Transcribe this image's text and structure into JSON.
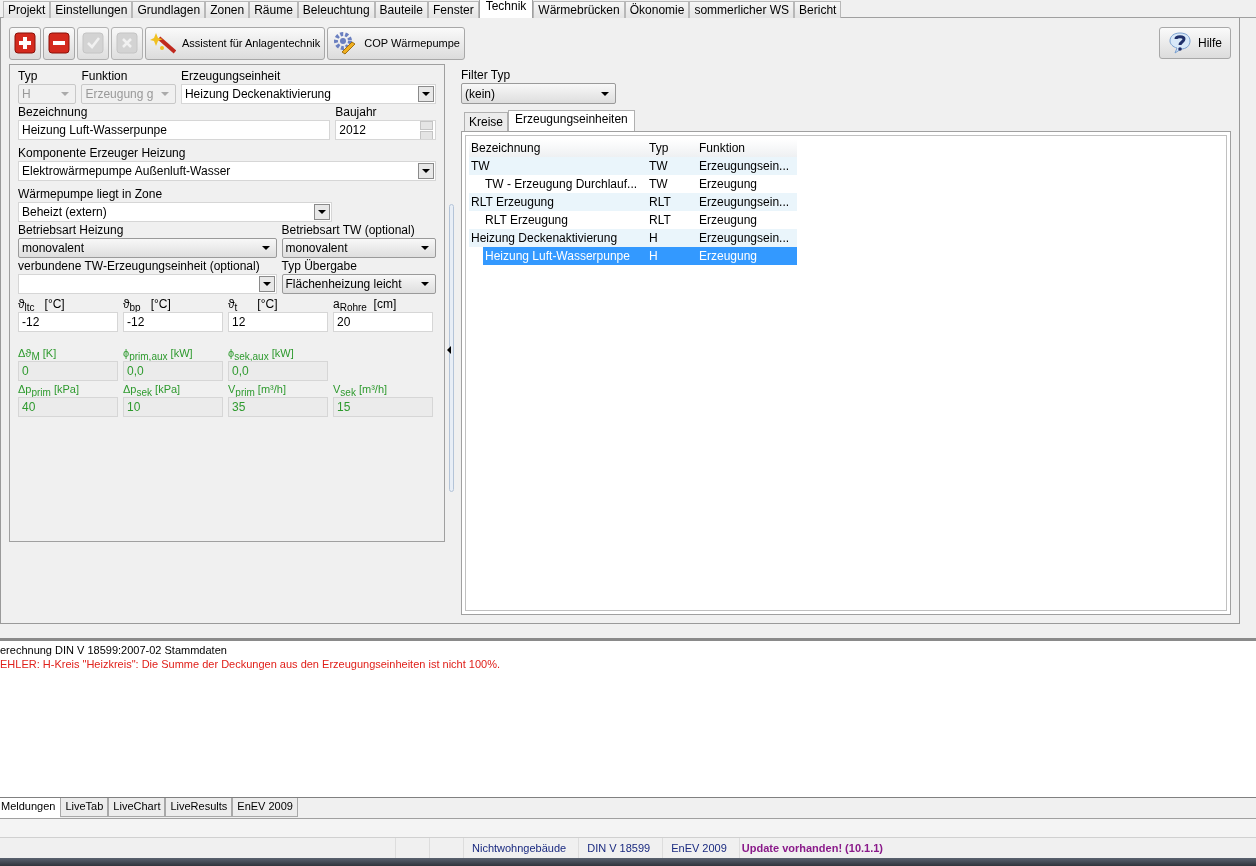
{
  "main_tabs": [
    {
      "label": "Projekt",
      "selected": false
    },
    {
      "label": "Einstellungen",
      "selected": false
    },
    {
      "label": "Grundlagen",
      "selected": false
    },
    {
      "label": "Zonen",
      "selected": false
    },
    {
      "label": "Räume",
      "selected": false
    },
    {
      "label": "Beleuchtung",
      "selected": false
    },
    {
      "label": "Bauteile",
      "selected": false
    },
    {
      "label": "Fenster",
      "selected": false
    },
    {
      "label": "Technik",
      "selected": true
    },
    {
      "label": "Wärmebrücken",
      "selected": false
    },
    {
      "label": "Ökonomie",
      "selected": false
    },
    {
      "label": "sommerlicher WS",
      "selected": false
    },
    {
      "label": "Bericht",
      "selected": false
    }
  ],
  "toolbar": {
    "buttons": [
      {
        "kind": "add",
        "disabled": false
      },
      {
        "kind": "remove",
        "disabled": false
      },
      {
        "kind": "confirm",
        "disabled": true
      },
      {
        "kind": "cancel",
        "disabled": true
      },
      {
        "kind": "wizard",
        "label": "Assistent für Anlagentechnik",
        "disabled": false
      },
      {
        "kind": "cop",
        "label": "COP Wärmepumpe",
        "disabled": false
      }
    ],
    "help": {
      "label": "Hilfe"
    }
  },
  "form": {
    "rows": [
      [
        {
          "label": "Typ",
          "value": "H",
          "kind": "dropdown",
          "disabled": true
        },
        {
          "label": "Funktion",
          "value": "Erzeugung g",
          "kind": "dropdown",
          "disabled": true
        },
        {
          "label": "Erzeugungseinheit",
          "value": "Heizung Deckenaktivierung",
          "kind": "combo",
          "disabled": false
        }
      ],
      [
        {
          "label": "Bezeichnung",
          "value": "Heizung Luft-Wasserpunpe",
          "kind": "text",
          "disabled": false
        },
        {
          "label": "Baujahr",
          "value": "2012",
          "kind": "spin",
          "disabled": false
        }
      ],
      [
        {
          "label": "Komponente Erzeuger Heizung",
          "value": "Elektrowärmepumpe Außenluft-Wasser",
          "kind": "combo",
          "disabled": false
        }
      ],
      [
        {
          "label": "Wärmepumpe liegt in Zone",
          "value": "Beheizt (extern)",
          "kind": "combo",
          "disabled": false
        }
      ],
      [
        {
          "label": "Betriebsart Heizung",
          "value": "monovalent",
          "kind": "dropdown",
          "disabled": false
        },
        {
          "label": "Betriebsart TW (optional)",
          "value": "monovalent",
          "kind": "dropdown",
          "disabled": false
        }
      ],
      [
        {
          "label": "verbundene TW-Erzeugungseinheit (optional)",
          "kind": "combo",
          "disabled": false
        },
        {
          "label": "Typ Übergabe",
          "value": "Flächenheizung leicht",
          "kind": "dropdown",
          "disabled": false
        }
      ],
      [
        {
          "label": "ϑ$_{ltc}$   [°C]",
          "value": "-12",
          "kind": "text",
          "disabled": false
        },
        {
          "label": "ϑ$_{bp}$   [°C]",
          "value": "-12",
          "kind": "text",
          "disabled": false
        },
        {
          "label": "ϑ$_{t}$      [°C]",
          "value": "12",
          "kind": "text",
          "disabled": false
        },
        {
          "label": "a$_{Rohre}$  [cm]",
          "value": "20",
          "kind": "text",
          "disabled": false
        }
      ],
      [
        {
          "label": "Δϑ$_{M}$ [K]",
          "value": "0",
          "kind": "text",
          "disabled": true
        },
        {
          "label": "ϕ$_{prim,aux}$ [kW]",
          "value": "0,0",
          "kind": "text",
          "disabled": true
        },
        {
          "label": "ϕ$_{sek,aux}$ [kW]",
          "value": "0,0",
          "kind": "text",
          "disabled": true
        }
      ],
      [
        {
          "label": "Δp$_{prim}$ [kPa]",
          "value": "40",
          "kind": "text",
          "disabled": true
        },
        {
          "label": "Δp$_{sek}$ [kPa]",
          "value": "10",
          "kind": "text",
          "disabled": true
        },
        {
          "label": "V$_{prim}$ [m³/h]",
          "value": "35",
          "kind": "text",
          "disabled": true
        },
        {
          "label": "V$_{sek}$ [m³/h]",
          "value": "15",
          "kind": "text",
          "disabled": true
        }
      ]
    ]
  },
  "filter": {
    "label": "Filter Typ",
    "value": "(kein)"
  },
  "sub_tabs": [
    {
      "label": "Kreise",
      "selected": false
    },
    {
      "label": "Erzeugungseinheiten",
      "selected": true
    }
  ],
  "tree": {
    "columns": [
      "Bezeichnung",
      "Typ",
      "Funktion"
    ],
    "rows": [
      {
        "cells": [
          "TW",
          "TW",
          "Erzeugungsein..."
        ],
        "selected": false,
        "children": [
          {
            "cells": [
              "TW - Erzeugung Durchlauf...",
              "TW",
              "Erzeugung"
            ],
            "selected": false
          }
        ]
      },
      {
        "cells": [
          "RLT Erzeugung",
          "RLT",
          "Erzeugungsein..."
        ],
        "selected": false,
        "children": [
          {
            "cells": [
              "RLT Erzeugung",
              "RLT",
              "Erzeugung"
            ],
            "selected": false
          }
        ]
      },
      {
        "cells": [
          "Heizung Deckenaktivierung",
          "H",
          "Erzeugungsein..."
        ],
        "selected": false,
        "children": [
          {
            "cells": [
              "Heizung Luft-Wasserpunpe",
              "H",
              "Erzeugung"
            ],
            "selected": true
          }
        ]
      }
    ]
  },
  "messages": [
    {
      "text": "erechnung DIN V 18599:2007-02 Stammdaten",
      "kind": "info"
    },
    {
      "text": "EHLER: H-Kreis \"Heizkreis\": Die Summe der Deckungen aus den Erzeugungseinheiten ist nicht 100%.",
      "kind": "error"
    }
  ],
  "bottom_tabs": [
    {
      "label": "Meldungen",
      "selected": true
    },
    {
      "label": "LiveTab",
      "selected": false
    },
    {
      "label": "LiveChart",
      "selected": false
    },
    {
      "label": "LiveResults",
      "selected": false
    },
    {
      "label": "EnEV 2009",
      "selected": false
    }
  ],
  "status_bar": [
    {
      "text": "Nichtwohngebäude",
      "kind": "plain"
    },
    {
      "text": "DIN V 18599",
      "kind": "plain"
    },
    {
      "text": "EnEV 2009",
      "kind": "plain"
    },
    {
      "text": "Update vorhanden! (10.1.1)",
      "kind": "update"
    }
  ]
}
